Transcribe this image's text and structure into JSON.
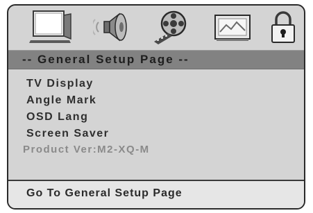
{
  "tabs": [
    {
      "icon": "tv-icon",
      "label": ""
    },
    {
      "icon": "speaker-icon",
      "label": ""
    },
    {
      "icon": "film-reel-icon",
      "label": ""
    },
    {
      "icon": "picture-icon",
      "label": ""
    },
    {
      "icon": "lock-icon",
      "label": ""
    }
  ],
  "header": {
    "title": "-- General Setup Page --"
  },
  "menu": {
    "items": [
      {
        "label": "TV Display"
      },
      {
        "label": "Angle Mark"
      },
      {
        "label": "OSD Lang"
      },
      {
        "label": "Screen Saver"
      }
    ]
  },
  "info": {
    "version": "Product Ver:M2-XQ-M"
  },
  "status": {
    "text": "Go To General Setup Page"
  },
  "colors": {
    "panel": "#d4d4d4",
    "title_bar": "#828282",
    "status_bar": "#e6e6e6",
    "text": "#2e2e2e",
    "dim_text": "#8a8a8a"
  }
}
